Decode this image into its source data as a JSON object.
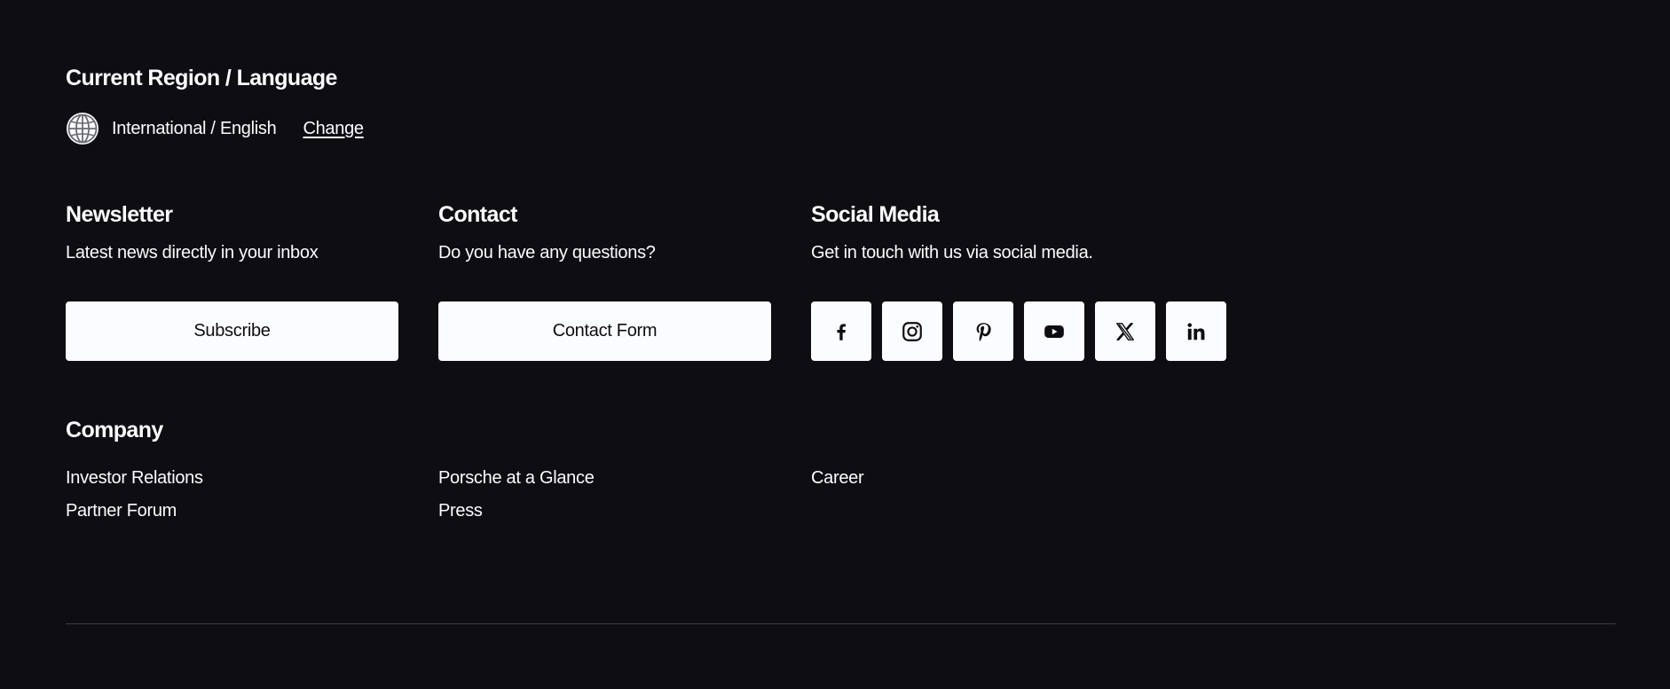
{
  "region": {
    "heading": "Current Region / Language",
    "current": "International / English",
    "change_label": "Change",
    "icon": "globe-icon"
  },
  "newsletter": {
    "heading": "Newsletter",
    "description": "Latest news directly in your inbox",
    "button_label": "Subscribe"
  },
  "contact": {
    "heading": "Contact",
    "description": "Do you have any questions?",
    "button_label": "Contact Form"
  },
  "social": {
    "heading": "Social Media",
    "description": "Get in touch with us via social media.",
    "icons": [
      "facebook-icon",
      "instagram-icon",
      "pinterest-icon",
      "youtube-icon",
      "x-icon",
      "linkedin-icon"
    ]
  },
  "company": {
    "heading": "Company",
    "links": [
      "Investor Relations",
      "Partner Forum",
      "Porsche at a Glance",
      "Press",
      "Career"
    ]
  },
  "colors": {
    "background": "#0e0e12",
    "text": "#fbfcff",
    "button_bg": "#fbfcff",
    "divider": "#3b3b42"
  }
}
